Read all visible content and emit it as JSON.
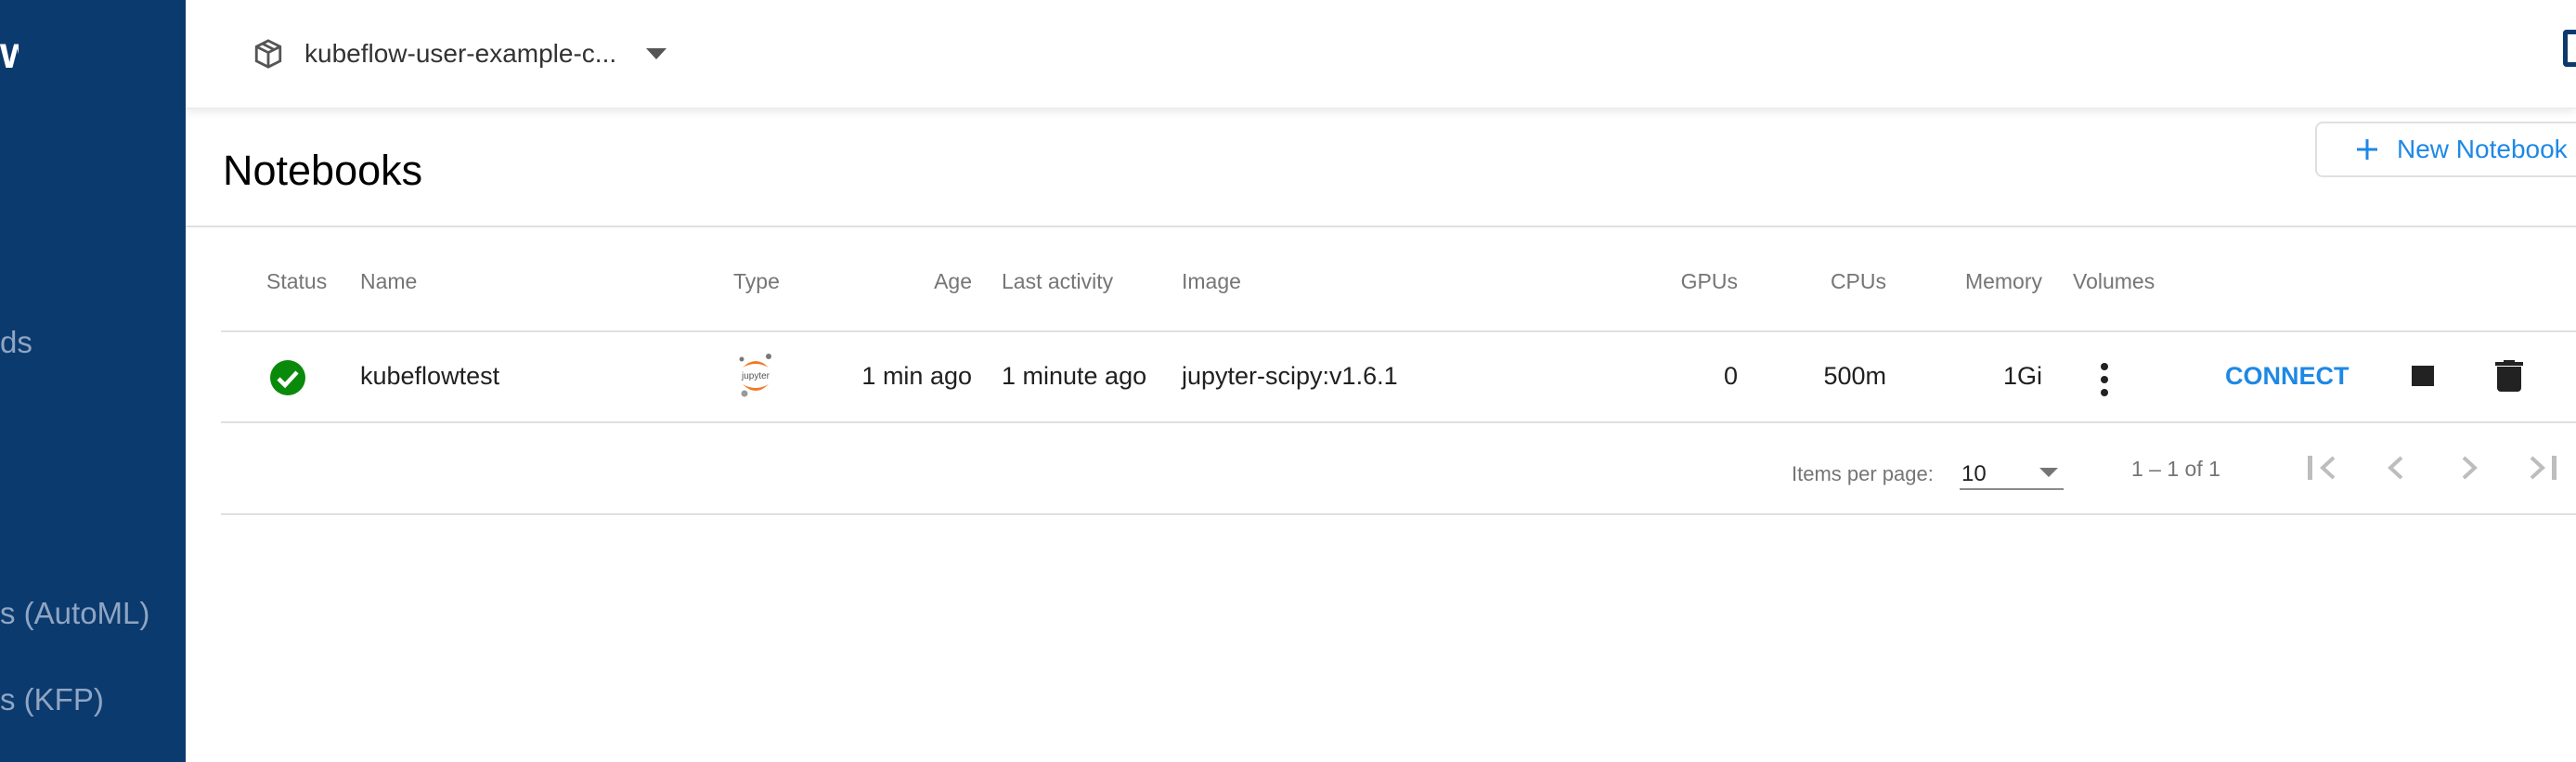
{
  "sidebar": {
    "logo_fragment": "w",
    "items": [
      {
        "label": "ds"
      },
      {
        "label": "s (AutoML)"
      },
      {
        "label": "s (KFP)"
      }
    ]
  },
  "header": {
    "namespace": "kubeflow-user-example-c..."
  },
  "page": {
    "title": "Notebooks",
    "new_button_label": "New Notebook"
  },
  "table": {
    "columns": [
      "Status",
      "Name",
      "Type",
      "Age",
      "Last activity",
      "Image",
      "GPUs",
      "CPUs",
      "Memory",
      "Volumes"
    ],
    "rows": [
      {
        "status": "ready",
        "name": "kubeflowtest",
        "type": "jupyter",
        "age": "1 min ago",
        "last_activity": "1 minute ago",
        "image": "jupyter-scipy:v1.6.1",
        "gpus": "0",
        "cpus": "500m",
        "memory": "1Gi",
        "connect_label": "CONNECT"
      }
    ]
  },
  "pagination": {
    "items_per_page_label": "Items per page:",
    "items_per_page": "10",
    "range": "1 – 1 of 1"
  },
  "colors": {
    "sidebar": "#0b3a6e",
    "accent": "#1e88e5",
    "status_ok": "#0a8a0a",
    "jupyter_orange": "#f37726"
  }
}
